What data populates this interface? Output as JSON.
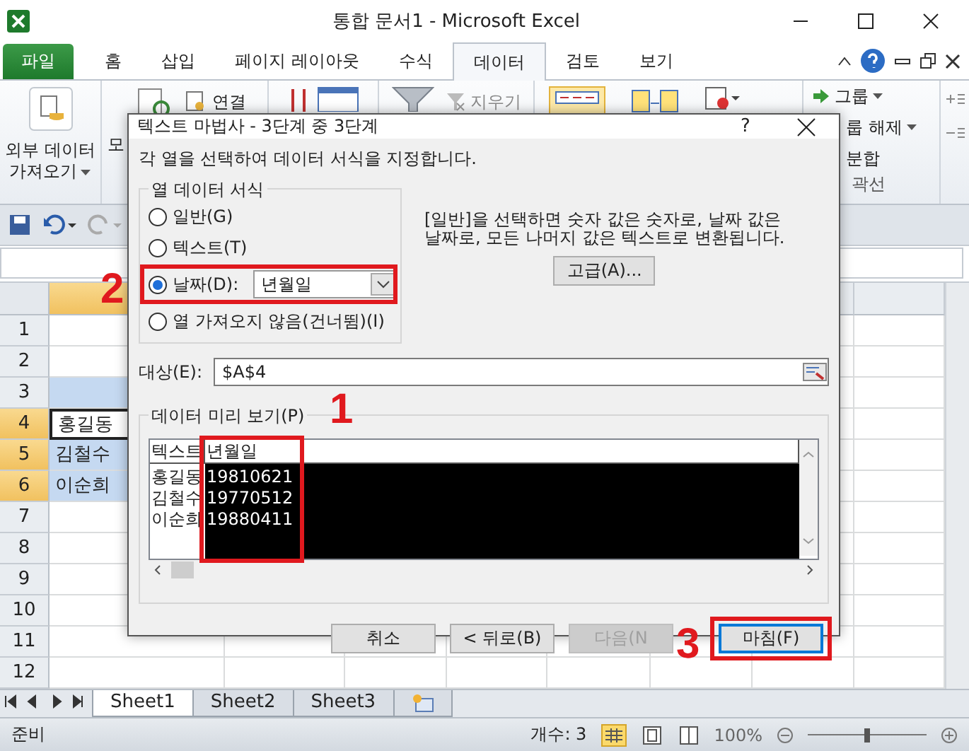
{
  "window": {
    "title": "통합 문서1  -  Microsoft Excel"
  },
  "ribbon_tabs": [
    {
      "label": "파일",
      "kind": "file",
      "selected": false
    },
    {
      "label": "홈",
      "kind": "tab",
      "selected": false
    },
    {
      "label": "삽입",
      "kind": "tab",
      "selected": false
    },
    {
      "label": "페이지 레이아웃",
      "kind": "tab",
      "selected": false
    },
    {
      "label": "수식",
      "kind": "tab",
      "selected": false
    },
    {
      "label": "데이터",
      "kind": "tab",
      "selected": true
    },
    {
      "label": "검토",
      "kind": "tab",
      "selected": false
    },
    {
      "label": "보기",
      "kind": "tab",
      "selected": false
    }
  ],
  "ribbon": {
    "external_data": [
      "외부 데이터",
      "가져오기"
    ],
    "fragment": "모",
    "connections": "연결",
    "clear": "지우기",
    "outline_items": [
      "그룹",
      "룹 해제",
      "분합"
    ],
    "outline_label": "곽선"
  },
  "column_headers": [
    {
      "selected": true
    },
    {
      "selected": false
    },
    {
      "selected": false
    }
  ],
  "rows": [
    {
      "header": "1",
      "selected": false,
      "kind": "plain"
    },
    {
      "header": "2",
      "selected": false,
      "kind": "plain"
    },
    {
      "header": "3",
      "selected": false,
      "kind": "highlighted"
    },
    {
      "header": "4",
      "selected": true,
      "kind": "active",
      "cell": "홍길동"
    },
    {
      "header": "5",
      "selected": true,
      "kind": "highlighted",
      "cell": "김철수"
    },
    {
      "header": "6",
      "selected": true,
      "kind": "highlighted",
      "cell": "이순희"
    },
    {
      "header": "7",
      "selected": false,
      "kind": "plain"
    },
    {
      "header": "8",
      "selected": false,
      "kind": "plain"
    },
    {
      "header": "9",
      "selected": false,
      "kind": "plain"
    },
    {
      "header": "10",
      "selected": false,
      "kind": "plain"
    },
    {
      "header": "11",
      "selected": false,
      "kind": "plain"
    },
    {
      "header": "12",
      "selected": false,
      "kind": "plain"
    }
  ],
  "dialog": {
    "title": "텍스트 마법사 - 3단계 중 3단계",
    "help": "?",
    "instruction": "각 열을 선택하여 데이터 서식을 지정합니다.",
    "format_group": {
      "label": "열 데이터 서식",
      "options": [
        {
          "label": "일반(G)",
          "kind": "radio",
          "selected": false
        },
        {
          "label": "텍스트(T)",
          "kind": "radio",
          "selected": false
        },
        {
          "label": "날짜(D):",
          "kind": "radio_select",
          "selected": true,
          "value": "년월일"
        },
        {
          "label": "열 가져오지 않음(건너뜀)(I)",
          "kind": "radio",
          "selected": false
        }
      ]
    },
    "note": [
      "[일반]을 선택하면 숫자 값은 숫자로, 날짜 값은",
      "날짜로, 모든 나머지 값은 텍스트로 변환됩니다."
    ],
    "advanced_button": "고급(A)...",
    "destination": {
      "label": "대상(E):",
      "value": "$A$4"
    },
    "preview": {
      "label": "데이터 미리 보기(P)",
      "columns": [
        {
          "header": "텍스트",
          "selected": false,
          "cells": [
            "홍길동",
            "김철수",
            "이순희"
          ]
        },
        {
          "header": "년월일",
          "selected": true,
          "cells": [
            "19810621",
            "19770512",
            "19880411"
          ]
        }
      ]
    },
    "buttons": [
      {
        "label": "취소",
        "disabled": false,
        "focused": false
      },
      {
        "label": "< 뒤로(B)",
        "disabled": false,
        "focused": false
      },
      {
        "label": "다음(N",
        "disabled": true,
        "focused": false
      },
      {
        "label": "마침(F)",
        "disabled": false,
        "focused": true
      }
    ]
  },
  "sheet_tabs": [
    {
      "label": "Sheet1",
      "selected": true
    },
    {
      "label": "Sheet2",
      "selected": false
    },
    {
      "label": "Sheet3",
      "selected": false
    }
  ],
  "status_bar": {
    "ready": "준비",
    "count": "개수: 3",
    "zoom": "100%",
    "zoom_slider": {
      "level": 0.5
    }
  },
  "annotations": [
    {
      "label": "1"
    },
    {
      "label": "2"
    },
    {
      "label": "3"
    }
  ]
}
